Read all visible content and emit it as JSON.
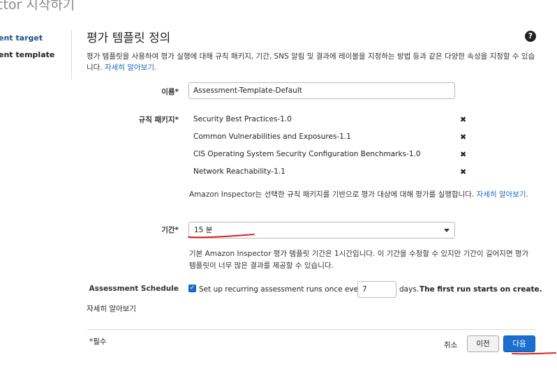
{
  "page_title": "ctor 시작하기",
  "steps": {
    "target": "ent target",
    "template": "ent template"
  },
  "section": {
    "title": "평가 템플릿 정의",
    "help_icon": "question-circle-icon",
    "description": "평가 템플릿을 사용하여 평가 실행에 대해 규칙 패키지, 기간, SNS 알림 및 결과에 레이블을 지정하는 방법 등과 같은 다양한 속성을 지정할 수 있습니다.",
    "learn_more": "자세히 알아보기."
  },
  "form": {
    "name_label": "이름*",
    "name_value": "Assessment-Template-Default",
    "rules_label": "규칙 패키지*",
    "rules": [
      "Security Best Practices-1.0",
      "Common Vulnerabilities and Exposures-1.1",
      "CIS Operating System Security Configuration Benchmarks-1.0",
      "Network Reachability-1.1"
    ],
    "remove_glyph": "✖",
    "rules_help": "Amazon Inspector는 선택한 규칙 패키지를 기반으로 평가 대상에 대해 평가를 실행합니다.",
    "rules_help_link": "자세히 알아보기.",
    "duration_label": "기간*",
    "duration_value": "15 분",
    "duration_help": "기본 Amazon Inspector 평가 템플릿 기간은 1시간입니다. 이 기간을 수정할 수 있지만 기간이 길어지면 평가 템플릿이 너무 많은 결과를 제공할 수 있습니다.",
    "schedule_label": "Assessment Schedule",
    "schedule_checked": true,
    "schedule_text": "Set up recurring assessment runs once every",
    "schedule_days": "7",
    "schedule_suffix": "days.",
    "schedule_first_run": "The first run starts on create.",
    "learn_more": "자세히 알아보기"
  },
  "footer": {
    "required_note": "*필수",
    "cancel": "취소",
    "prev": "이전",
    "next": "다음"
  },
  "colors": {
    "accent": "#1a6fd0",
    "link": "#1a66c0",
    "annotation": "#e02020"
  }
}
